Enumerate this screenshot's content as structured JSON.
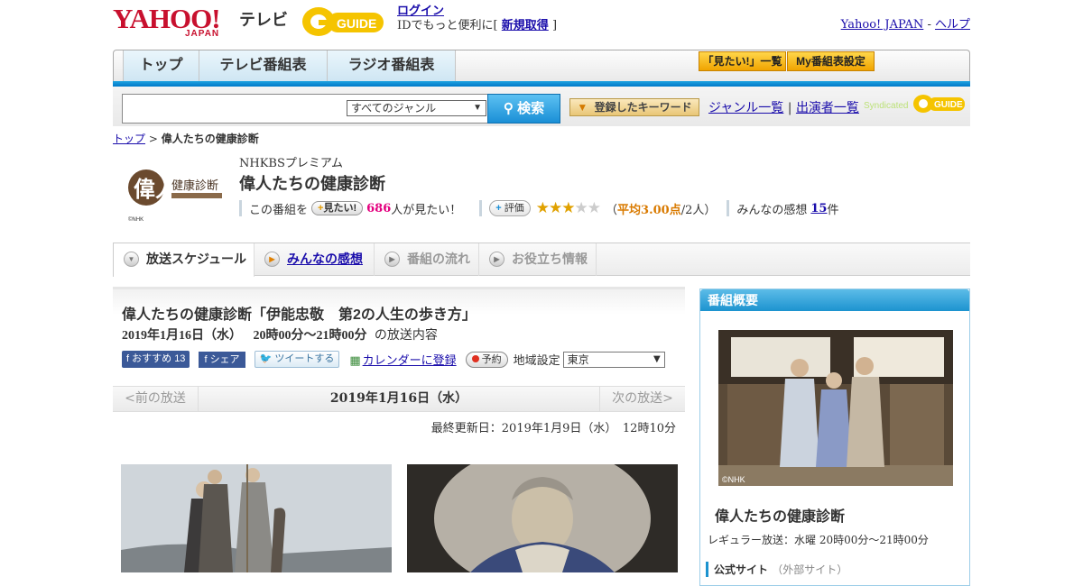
{
  "header": {
    "logo_text": "YAHOO!",
    "logo_sub": "JAPAN",
    "tv_label": "テレビ",
    "gguide_label": "GUIDE",
    "login_link": "ログイン",
    "login_prompt": "IDでもっと便利に[",
    "register_link": "新規取得",
    "login_suffix": "]",
    "yahoo_japan_link": "Yahoo! JAPAN",
    "separator": "-",
    "help_link": "ヘルプ"
  },
  "nav": {
    "tabs": [
      "トップ",
      "テレビ番組表",
      "ラジオ番組表"
    ],
    "mitai_list": "「見たい!」一覧",
    "my_settings": "My番組表設定"
  },
  "search": {
    "placeholder": "",
    "genre_selected": "すべてのジャンル",
    "button_label": "検索",
    "keyword_button": "登録したキーワード",
    "genre_list_link": "ジャンル一覧",
    "divider": "|",
    "performer_list_link": "出演者一覧",
    "syndicated": "Syndicated"
  },
  "breadcrumb": {
    "top": "トップ",
    "separator": ">",
    "current": "偉人たちの健康診断"
  },
  "program": {
    "thumb_title": "偉人",
    "thumb_sub": "健康診断",
    "thumb_copyright": "©NHK",
    "channel": "NHKBSプレミアム",
    "title": "偉人たちの健康診断",
    "want_prefix": "この番組を",
    "want_button": "見たい!",
    "want_count": "686",
    "want_suffix": "人が見たい！",
    "rating_button": "評価",
    "rating_value": 3,
    "rating_max": 5,
    "rating_open": "（",
    "rating_avg": "平均3.00点",
    "rating_people": "/2人）",
    "comments_label": "みんなの感想",
    "comments_count": "15",
    "comments_unit": "件"
  },
  "subtabs": {
    "schedule": "放送スケジュール",
    "comments": "みんなの感想",
    "flow": "番組の流れ",
    "info": "お役立ち情報"
  },
  "episode": {
    "title": "偉人たちの健康診断「伊能忠敬　第2の人生の歩き方」",
    "date": "2019年1月16日（水）",
    "time": "20時00分～21時00分",
    "suffix": "の放送内容",
    "fb_recommend": "おすすめ",
    "fb_recommend_count": "13",
    "fb_share": "シェア",
    "tweet": "ツイートする",
    "calendar": "カレンダーに登録",
    "reserve": "予約",
    "region_label": "地域設定",
    "region_selected": "東京",
    "prev": "<前の放送",
    "current_date": "2019年1月16日（水）",
    "next": "次の放送>",
    "updated": "最終更新日：2019年1月9日（水）　12時10分"
  },
  "sidebar": {
    "header": "番組概要",
    "image_credit": "©NHK",
    "title": "偉人たちの健康診断",
    "regular": "レギュラー放送：水曜 20時00分～21時00分",
    "official_label": "公式サイト",
    "official_note": "（外部サイト）"
  }
}
